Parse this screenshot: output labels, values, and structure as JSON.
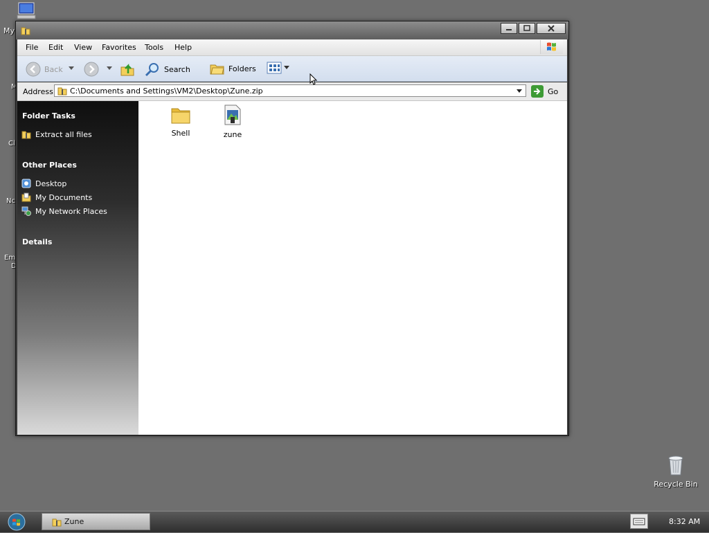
{
  "desktop": {
    "icons": [
      {
        "name": "My Computer",
        "label": "My"
      },
      {
        "name": "Recycle Bin",
        "label": "Recycle Bin"
      }
    ],
    "clipped_labels": [
      "M",
      "Cl",
      "Nc",
      "Em",
      "D"
    ]
  },
  "window": {
    "title": "",
    "menu": [
      "File",
      "Edit",
      "View",
      "Favorites",
      "Tools",
      "Help"
    ],
    "toolbar": {
      "back_label": "Back",
      "search_label": "Search",
      "folders_label": "Folders"
    },
    "address": {
      "label": "Address",
      "value": "C:\\Documents and Settings\\VM2\\Desktop\\Zune.zip",
      "go_label": "Go"
    },
    "left_pane": {
      "folder_tasks": {
        "title": "Folder Tasks",
        "items": [
          "Extract all files"
        ]
      },
      "other_places": {
        "title": "Other Places",
        "items": [
          "Desktop",
          "My Documents",
          "My Network Places"
        ]
      },
      "details": {
        "title": "Details"
      }
    },
    "files": [
      {
        "name": "Shell",
        "type": "folder"
      },
      {
        "name": "zune",
        "type": "image"
      }
    ]
  },
  "taskbar": {
    "button_label": "Zune",
    "clock": "8:32 AM"
  },
  "colors": {
    "desktop": "#6f6f6f",
    "taskbar": "#3a3a3a",
    "folder": "#f3cf5a"
  }
}
